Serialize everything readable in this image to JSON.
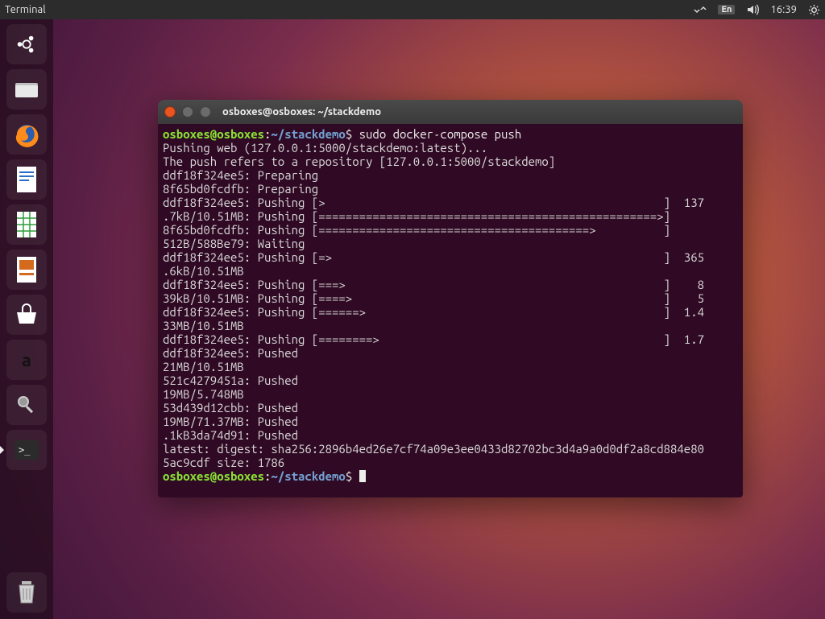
{
  "menubar": {
    "app_title": "Terminal",
    "lang": "En",
    "time": "16:39"
  },
  "launcher": {
    "items": [
      {
        "name": "dash-icon",
        "label": "Dash"
      },
      {
        "name": "files-icon",
        "label": "Files"
      },
      {
        "name": "firefox-icon",
        "label": "Firefox"
      },
      {
        "name": "writer-icon",
        "label": "LibreOffice Writer"
      },
      {
        "name": "calc-icon",
        "label": "LibreOffice Calc"
      },
      {
        "name": "impress-icon",
        "label": "LibreOffice Impress"
      },
      {
        "name": "software-icon",
        "label": "Ubuntu Software"
      },
      {
        "name": "amazon-icon",
        "label": "Amazon"
      },
      {
        "name": "settings-icon",
        "label": "System Settings"
      },
      {
        "name": "terminal-icon",
        "label": "Terminal"
      }
    ],
    "trash": {
      "name": "trash-icon",
      "label": "Trash"
    }
  },
  "terminal": {
    "title": "osboxes@osboxes: ~/stackdemo",
    "prompt_user": "osboxes@osboxes",
    "prompt_sep": ":",
    "prompt_path": "~/stackdemo",
    "prompt_sym": "$",
    "command": " sudo docker-compose push",
    "lines": [
      "Pushing web (127.0.0.1:5000/stackdemo:latest)...",
      "The push refers to a repository [127.0.0.1:5000/stackdemo]",
      "ddf18f324ee5: Preparing",
      "8f65bd0fcdfb: Preparing",
      "ddf18f324ee5: Pushing [>                                                  ]  137",
      ".7kB/10.51MB: Pushing [==================================================>]",
      "8f65bd0fcdfb: Pushing [========================================>          ]",
      "512B/588Be79: Waiting",
      "ddf18f324ee5: Pushing [=>                                                 ]  365",
      ".6kB/10.51MB",
      "ddf18f324ee5: Pushing [===>                                               ]    8",
      "39kB/10.51MB: Pushing [====>                                              ]    5",
      "ddf18f324ee5: Pushing [======>                                            ]  1.4",
      "33MB/10.51MB",
      "ddf18f324ee5: Pushing [========>                                          ]  1.7",
      "ddf18f324ee5: Pushed",
      "21MB/10.51MB",
      "521c4279451a: Pushed",
      "19MB/5.748MB",
      "53d439d12cbb: Pushed",
      "19MB/71.37MB: Pushed",
      ".1kB3da74d91: Pushed",
      "latest: digest: sha256:2896b4ed26e7cf74a09e3ee0433d82702bc3d4a9a0d0df2a8cd884e80",
      "5ac9cdf size: 1786"
    ]
  }
}
